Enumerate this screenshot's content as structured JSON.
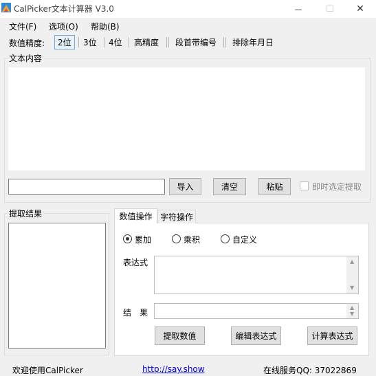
{
  "window": {
    "title": "CalPicker文本计算器 V3.0",
    "minimize_glyph": "—",
    "maximize_glyph": "☐",
    "close_glyph": "✕"
  },
  "menu": [
    "文件(F)",
    "选项(O)",
    "帮助(B)"
  ],
  "toolbar": {
    "precision_label": "数值精度:",
    "precision_options": [
      "2位",
      "3位",
      "4位",
      "高精度"
    ],
    "selected_precision": "2位",
    "paragraph_numbering": "段首带编号",
    "exclude_dates": "排除年月日"
  },
  "text_content": {
    "group_label": "文本内容",
    "value": "",
    "input_value": "",
    "import_button": "导入",
    "clear_button": "清空",
    "paste_button": "粘贴",
    "instant_extract_label": "即时选定提取",
    "instant_extract_checked": false
  },
  "extract_result": {
    "group_label": "提取结果",
    "items": []
  },
  "tabs": [
    {
      "label": "数值操作",
      "active": true
    },
    {
      "label": "字符操作",
      "active": false
    }
  ],
  "numeric_ops": {
    "radio_options": [
      "累加",
      "乘积",
      "自定义"
    ],
    "selected_option": "累加",
    "expression_label": "表达式",
    "expression_value": "",
    "result_label": "结　果",
    "result_value": "",
    "extract_button": "提取数值",
    "edit_expression_button": "编辑表达式",
    "calc_expression_button": "计算表达式"
  },
  "status_bar": {
    "welcome": "欢迎使用CalPicker",
    "link": "http://say.show",
    "contact": "在线服务QQ: 37022869"
  },
  "colors": {
    "window_bg": "#f0f0f0",
    "selected_border": "#7aa9d9",
    "link": "#0000ee"
  }
}
